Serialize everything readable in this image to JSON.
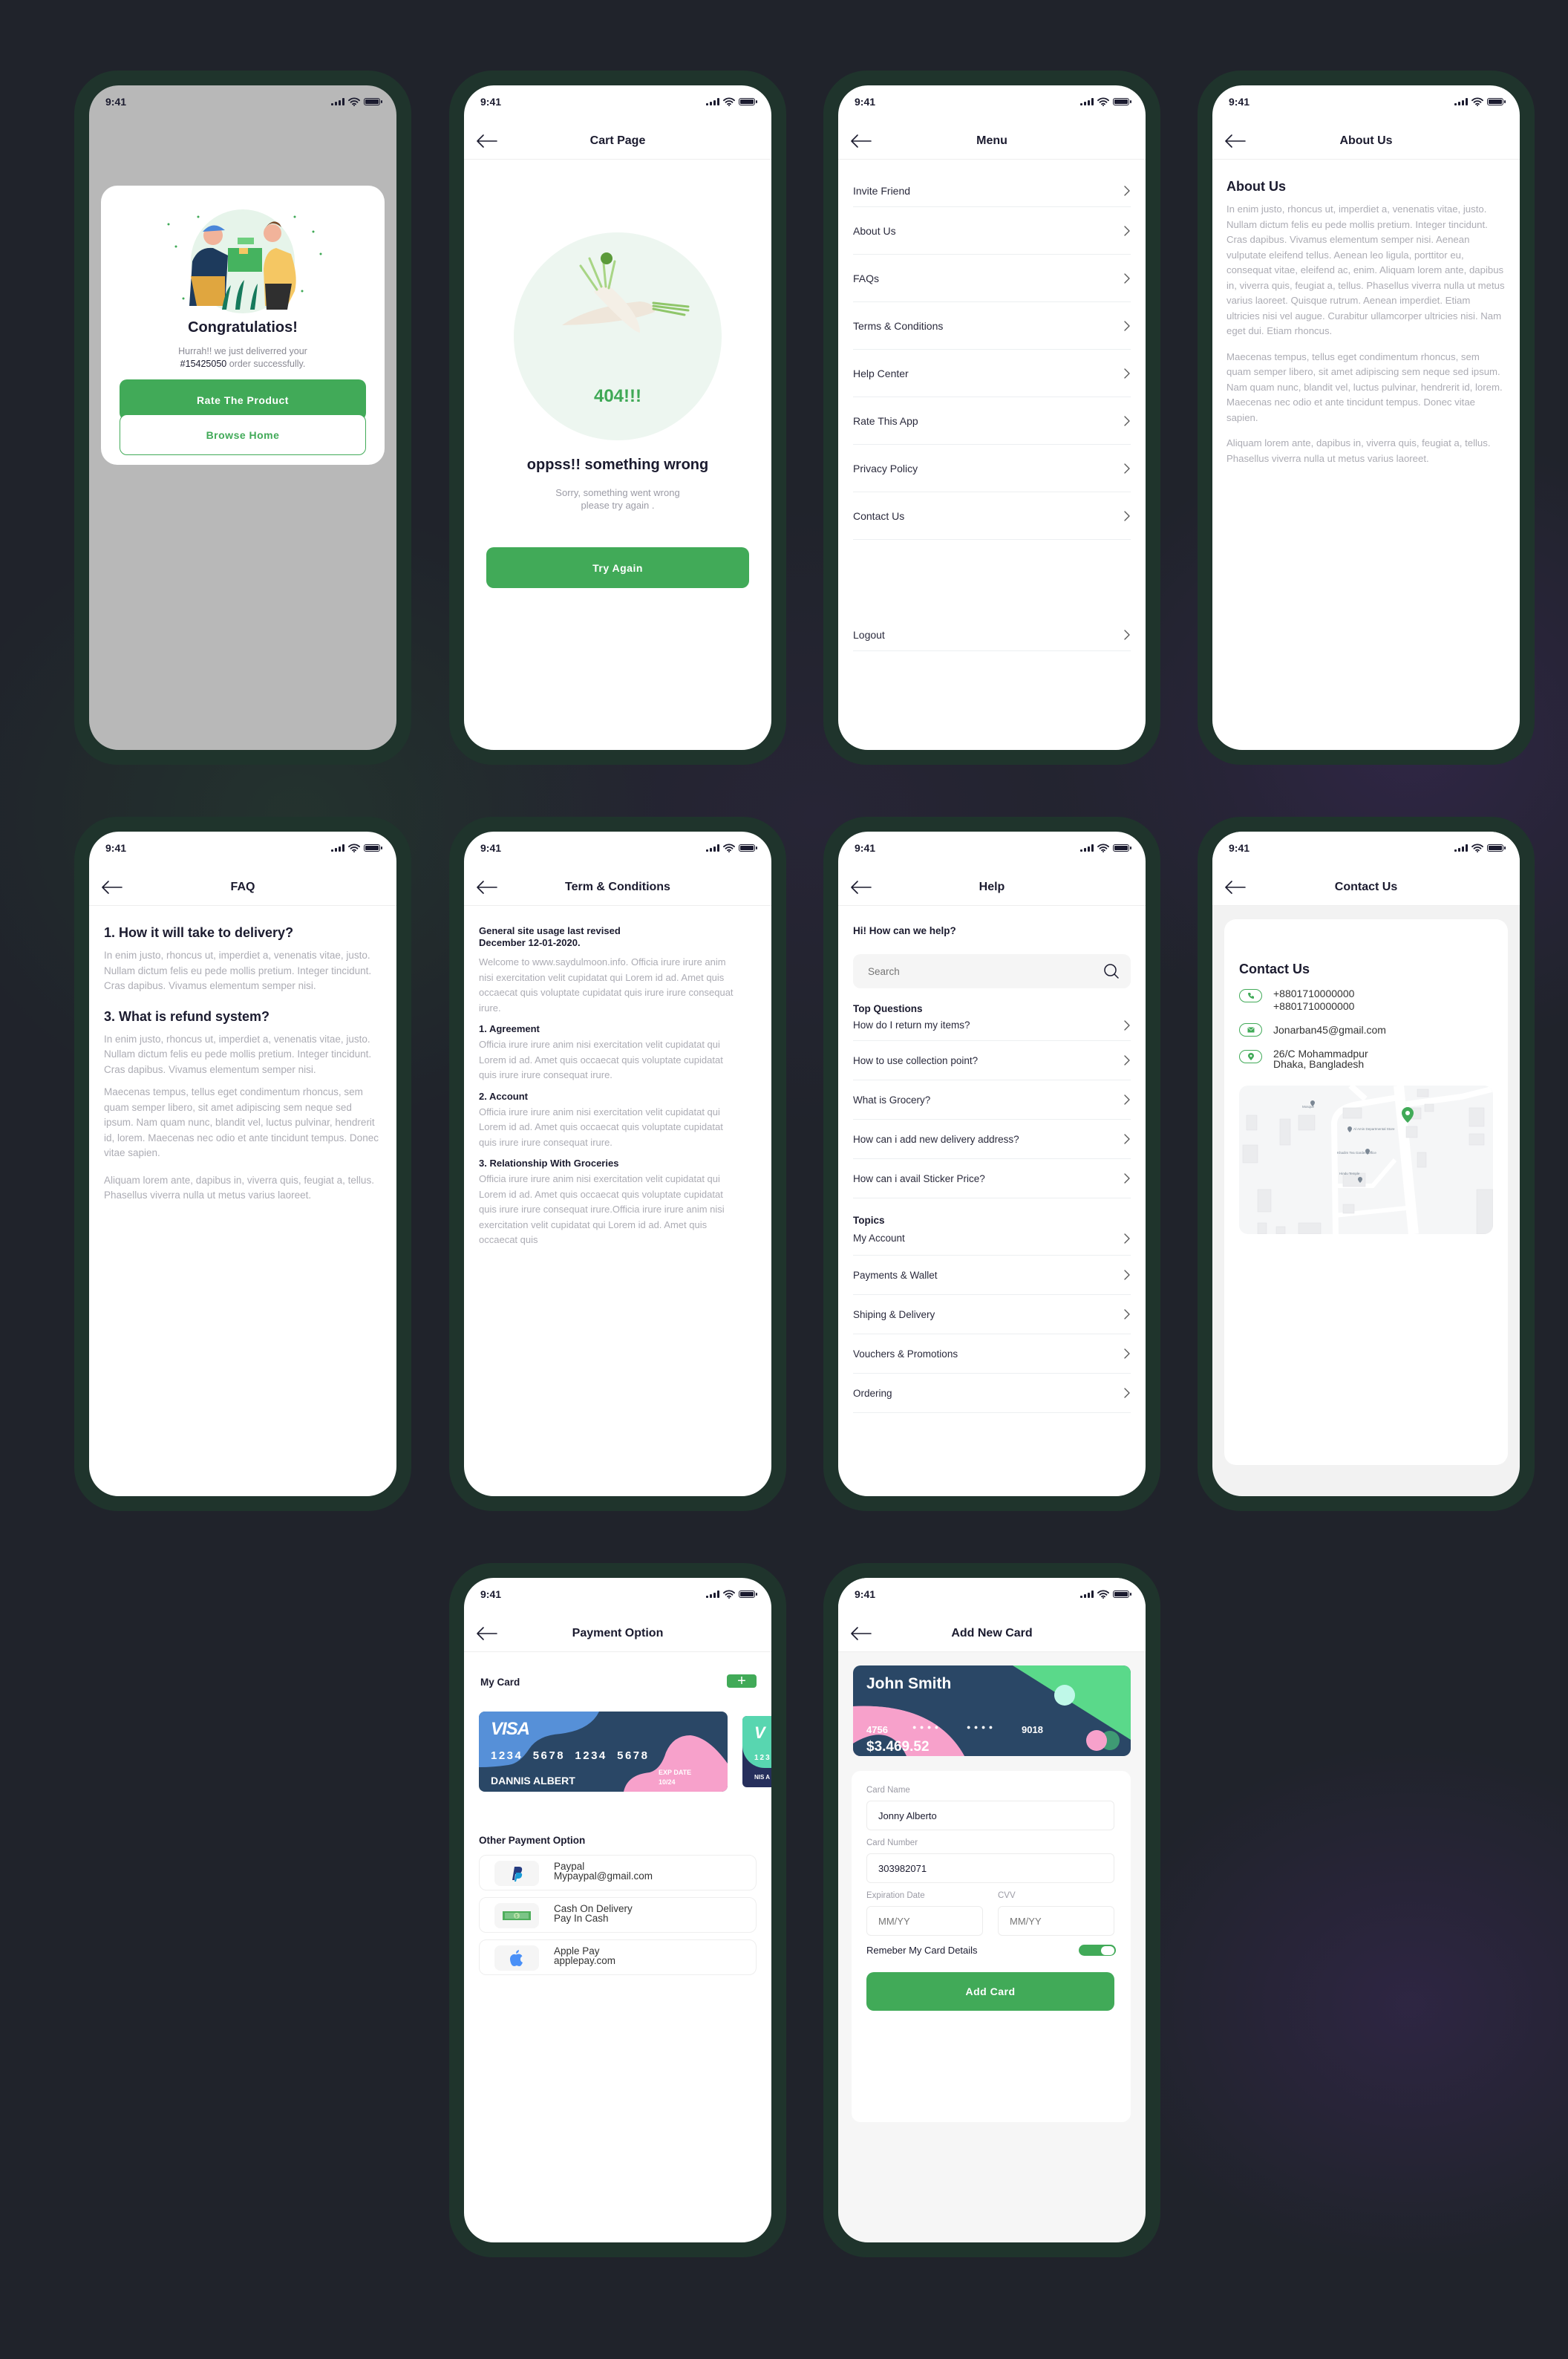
{
  "status_bar": {
    "time": "9:41"
  },
  "screens": {
    "success": {
      "title": "Congratulatios!",
      "message_line1": "Hurrah!!  we just deliverred your",
      "order_number": "#15425050",
      "message_line2": " order successfully.",
      "primary_button": "Rate The Product",
      "secondary_button": "Browse Home"
    },
    "error": {
      "header_title": "Cart Page",
      "code": "404!!!",
      "heading": "oppss!! something wrong",
      "message_line1": "Sorry, something went wrong",
      "message_line2": "please try again .",
      "button": "Try Again"
    },
    "menu": {
      "header_title": "Menu",
      "items": [
        "Invite Friend",
        "About Us",
        "FAQs",
        "Terms & Conditions",
        "Help Center",
        "Rate This App",
        "Privacy Policy",
        "Contact Us"
      ],
      "logout": "Logout"
    },
    "about": {
      "header_title": "About Us",
      "heading": "About Us",
      "paragraphs": [
        "In enim justo, rhoncus ut, imperdiet a, venenatis vitae, justo. Nullam dictum felis eu pede mollis pretium. Integer tincidunt. Cras dapibus. Vivamus elementum semper nisi. Aenean vulputate eleifend tellus. Aenean leo ligula, porttitor eu, consequat vitae, eleifend ac, enim. Aliquam lorem ante, dapibus in, viverra quis, feugiat a, tellus. Phasellus viverra nulla ut metus varius laoreet. Quisque rutrum. Aenean imperdiet. Etiam ultricies nisi vel augue. Curabitur ullamcorper ultricies nisi. Nam eget dui. Etiam rhoncus.",
        "Maecenas tempus, tellus eget condimentum rhoncus, sem quam semper libero, sit amet adipiscing sem neque sed ipsum. Nam quam nunc, blandit vel, luctus pulvinar, hendrerit id, lorem. Maecenas nec odio et ante tincidunt tempus. Donec vitae sapien.",
        "Aliquam lorem ante, dapibus in, viverra quis, feugiat a, tellus. Phasellus viverra nulla ut metus varius laoreet."
      ]
    },
    "faq": {
      "header_title": "FAQ",
      "q1": "1. How it will take to delivery?",
      "a1": "In enim justo, rhoncus ut, imperdiet a, venenatis vitae, justo. Nullam dictum felis eu pede mollis pretium. Integer tincidunt. Cras dapibus. Vivamus elementum semper nisi.",
      "q2": "3. What is refund system?",
      "a2": "In enim justo, rhoncus ut, imperdiet a, venenatis vitae, justo. Nullam dictum felis eu pede mollis pretium. Integer tincidunt. Cras dapibus. Vivamus elementum semper nisi.",
      "a3": "Maecenas tempus, tellus eget condimentum rhoncus, sem quam semper libero, sit amet adipiscing sem neque sed ipsum. Nam quam nunc, blandit vel, luctus pulvinar, hendrerit id, lorem. Maecenas nec odio et ante tincidunt tempus. Donec vitae sapien.",
      "a4": "Aliquam lorem ante, dapibus in, viverra quis, feugiat a, tellus. Phasellus viverra nulla ut metus varius laoreet."
    },
    "terms": {
      "header_title": "Term & Conditions",
      "revised_line1": "General site usage last revised",
      "revised_line2": "December 12-01-2020.",
      "intro": "Welcome to www.saydulmoon.info. Officia irure irure anim nisi exercitation velit cupidatat qui Lorem id ad. Amet quis occaecat quis voluptate cupidatat quis irure irure consequat irure.",
      "sections": [
        {
          "title": "1.  Agreement",
          "text": "Officia irure irure anim nisi exercitation velit cupidatat qui Lorem id ad. Amet quis occaecat quis voluptate cupidatat quis irure irure consequat irure."
        },
        {
          "title": "2.  Account",
          "text": "Officia irure irure anim nisi exercitation velit cupidatat qui Lorem id ad. Amet quis occaecat quis voluptate cupidatat quis irure irure consequat irure."
        },
        {
          "title": "3.  Relationship With Groceries",
          "text": "Officia irure irure anim nisi exercitation velit cupidatat qui Lorem id ad. Amet quis occaecat quis voluptate cupidatat quis irure irure consequat irure.Officia irure irure anim nisi exercitation velit cupidatat qui Lorem id ad. Amet quis occaecat quis"
        }
      ]
    },
    "help": {
      "header_title": "Help",
      "greeting": "Hi! How can we help?",
      "search_placeholder": "Search",
      "top_questions_label": "Top Questions",
      "top_questions": [
        "How do I return my items?",
        "How to use collection point?",
        "What is Grocery?",
        "How can i add new delivery address?",
        "How can i avail Sticker Price?"
      ],
      "topics_label": "Topics",
      "topics": [
        "My Account",
        "Payments & Wallet",
        "Shiping & Delivery",
        "Vouchers & Promotions",
        "Ordering"
      ]
    },
    "contact": {
      "header_title": "Contact Us",
      "heading": "Contact Us",
      "phone1": "+8801710000000",
      "phone2": "+8801710000000",
      "email": "Jonarban45@gmail.com",
      "address_line1": "26/C Mohammadpur",
      "address_line2": "Dhaka, Bangladesh",
      "map_labels": [
        "Mosque",
        "Al Amin Departmental Store",
        "Khadim Tea Garden Office",
        "Hindu Temple"
      ]
    },
    "payment": {
      "header_title": "Payment Option",
      "my_card_label": "My Card",
      "card": {
        "brand": "VISA",
        "number": "1234  5678  1234  5678",
        "holder": "DANNIS ALBERT",
        "exp_label": "EXP DATE",
        "exp": "10/24"
      },
      "card2": {
        "brand": "V",
        "number": "123",
        "holder": "NIS A"
      },
      "other_label": "Other Payment Option",
      "options": [
        {
          "name": "Paypal",
          "detail": "Mypaypal@gmail.com",
          "icon": "paypal-icon"
        },
        {
          "name": "Cash On Delivery",
          "detail": "Pay In Cash",
          "icon": "cash-icon"
        },
        {
          "name": "Apple Pay",
          "detail": "applepay.com",
          "icon": "apple-icon"
        }
      ]
    },
    "add_card": {
      "header_title": "Add New Card",
      "card": {
        "holder": "John Smith",
        "first": "4756",
        "mask1": "● ● ● ●",
        "mask2": "● ● ● ●",
        "last": "9018",
        "balance": "$3.469.52"
      },
      "card_name_label": "Card Name",
      "card_name_value": "Jonny Alberto",
      "card_number_label": "Card Number",
      "card_number_value": "303982071",
      "exp_label": "Expiration Date",
      "exp_placeholder": "MM/YY",
      "cvv_label": "CVV",
      "cvv_placeholder": "MM/YY",
      "remember_label": "Remeber My Card Details",
      "remember_on": true,
      "button": "Add Card"
    }
  },
  "colors": {
    "accent": "#41aa58",
    "dark": "#1b1b2f",
    "card_navy": "#2a4766",
    "pink": "#f7a1cb",
    "mint": "#5ad98a"
  }
}
